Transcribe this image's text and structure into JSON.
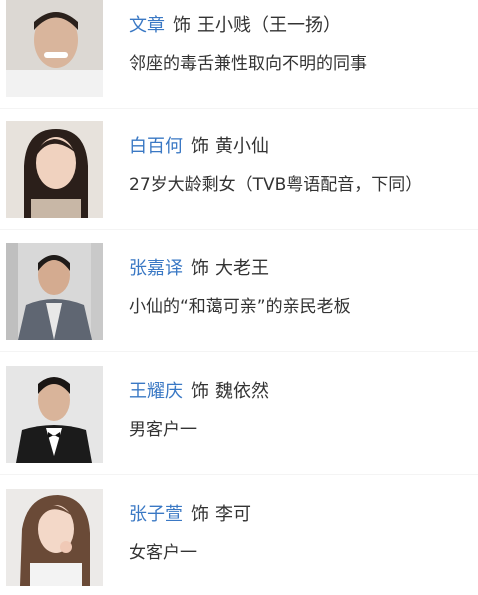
{
  "cast": [
    {
      "actor": "文章",
      "role_word": "饰",
      "role": "王小贱（王一扬）",
      "description": "邻座的毒舌兼性取向不明的同事",
      "photo_bg": "#dcd8d3",
      "outfit": "#f2f2f2"
    },
    {
      "actor": "白百何",
      "role_word": "饰",
      "role": "黄小仙",
      "description": "27岁大龄剩女（TVB粤语配音，下同）",
      "photo_bg": "#e7e2dc",
      "outfit": "#c8b7a6"
    },
    {
      "actor": "张嘉译",
      "role_word": "饰",
      "role": "大老王",
      "description": "小仙的“和蔼可亲”的亲民老板",
      "photo_bg": "#d8d8d8",
      "outfit": "#5f6672"
    },
    {
      "actor": "王耀庆",
      "role_word": "饰",
      "role": "魏依然",
      "description": "男客户一",
      "photo_bg": "#e6e6e6",
      "outfit": "#1b1b1b"
    },
    {
      "actor": "张子萱",
      "role_word": "饰",
      "role": "李可",
      "description": "女客户一",
      "photo_bg": "#eceae8",
      "outfit": "#f3f3f3"
    }
  ]
}
